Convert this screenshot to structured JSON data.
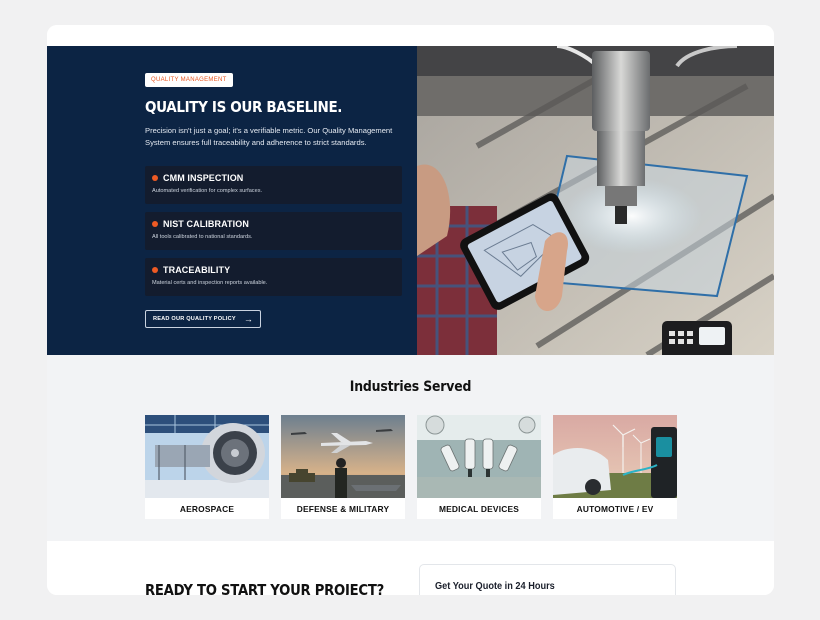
{
  "quality": {
    "badge": "QUALITY MANAGEMENT",
    "title": "QUALITY IS OUR BASELINE.",
    "description": "Precision isn't just a goal; it's a verifiable metric. Our Quality Management System ensures full traceability and adherence to strict standards.",
    "features": [
      {
        "title": "CMM INSPECTION",
        "subtitle": "Automated verification for complex surfaces."
      },
      {
        "title": "NIST CALIBRATION",
        "subtitle": "All tools calibrated to national standards."
      },
      {
        "title": "TRACEABILITY",
        "subtitle": "Material certs and inspection reports available."
      }
    ],
    "policy_button": "READ OUR QUALITY POLICY",
    "accent_color": "#ee5a24",
    "panel_color": "#0c2444"
  },
  "industries": {
    "title": "Industries Served",
    "cards": [
      {
        "label": "AEROSPACE",
        "icon": "jet-engine-image"
      },
      {
        "label": "DEFENSE & MILITARY",
        "icon": "military-image"
      },
      {
        "label": "MEDICAL DEVICES",
        "icon": "robotic-surgery-image"
      },
      {
        "label": "AUTOMOTIVE / EV",
        "icon": "ev-charging-image"
      }
    ]
  },
  "cta": {
    "title": "READY TO START YOUR PROJECT?",
    "quote_title": "Get Your Quote in 24 Hours"
  }
}
